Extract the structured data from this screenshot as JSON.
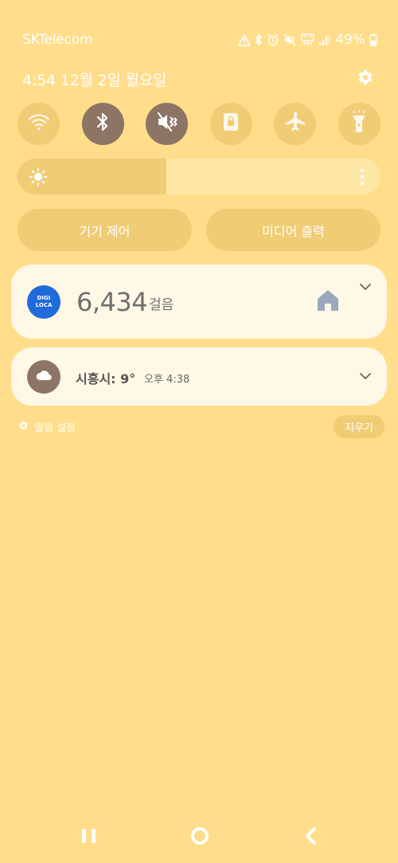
{
  "status_bar": {
    "carrier": "SKTelecom",
    "battery_text": "49%",
    "icons": [
      "alert-triangle-icon",
      "bluetooth-icon",
      "alarm-icon",
      "vibrate-mute-icon",
      "volte-icon",
      "signal-icon",
      "battery-icon"
    ]
  },
  "header": {
    "datetime": "4:54  12월 2일 월요일",
    "settings_icon": "gear-icon"
  },
  "quick_settings": {
    "tiles": [
      {
        "name": "wifi",
        "icon": "wifi-icon",
        "active": false
      },
      {
        "name": "bluetooth",
        "icon": "bluetooth-icon",
        "active": true
      },
      {
        "name": "sound",
        "icon": "mute-vibrate-icon",
        "active": true
      },
      {
        "name": "rotation-lock",
        "icon": "rotation-lock-icon",
        "active": false
      },
      {
        "name": "airplane",
        "icon": "airplane-icon",
        "active": false
      },
      {
        "name": "flashlight",
        "icon": "flashlight-icon",
        "active": false
      }
    ],
    "brightness_level": 0.41,
    "device_control_label": "기기 제어",
    "media_output_label": "미디어 출력"
  },
  "notifications": {
    "steps": {
      "app_logo_line1": "DIGI",
      "app_logo_line2": "LOCA",
      "count": "6,434",
      "unit": "걸음"
    },
    "weather": {
      "title": "시흥시: 9°",
      "time": "오후 4:38"
    },
    "settings_label": "알림 설정",
    "clear_label": "지우기"
  },
  "colors": {
    "background": "#ffdd8a",
    "tile_off": "#f0cc74",
    "tile_on": "#8d7565",
    "card": "#fff8e6",
    "digi_blue": "#1e6bdc"
  }
}
